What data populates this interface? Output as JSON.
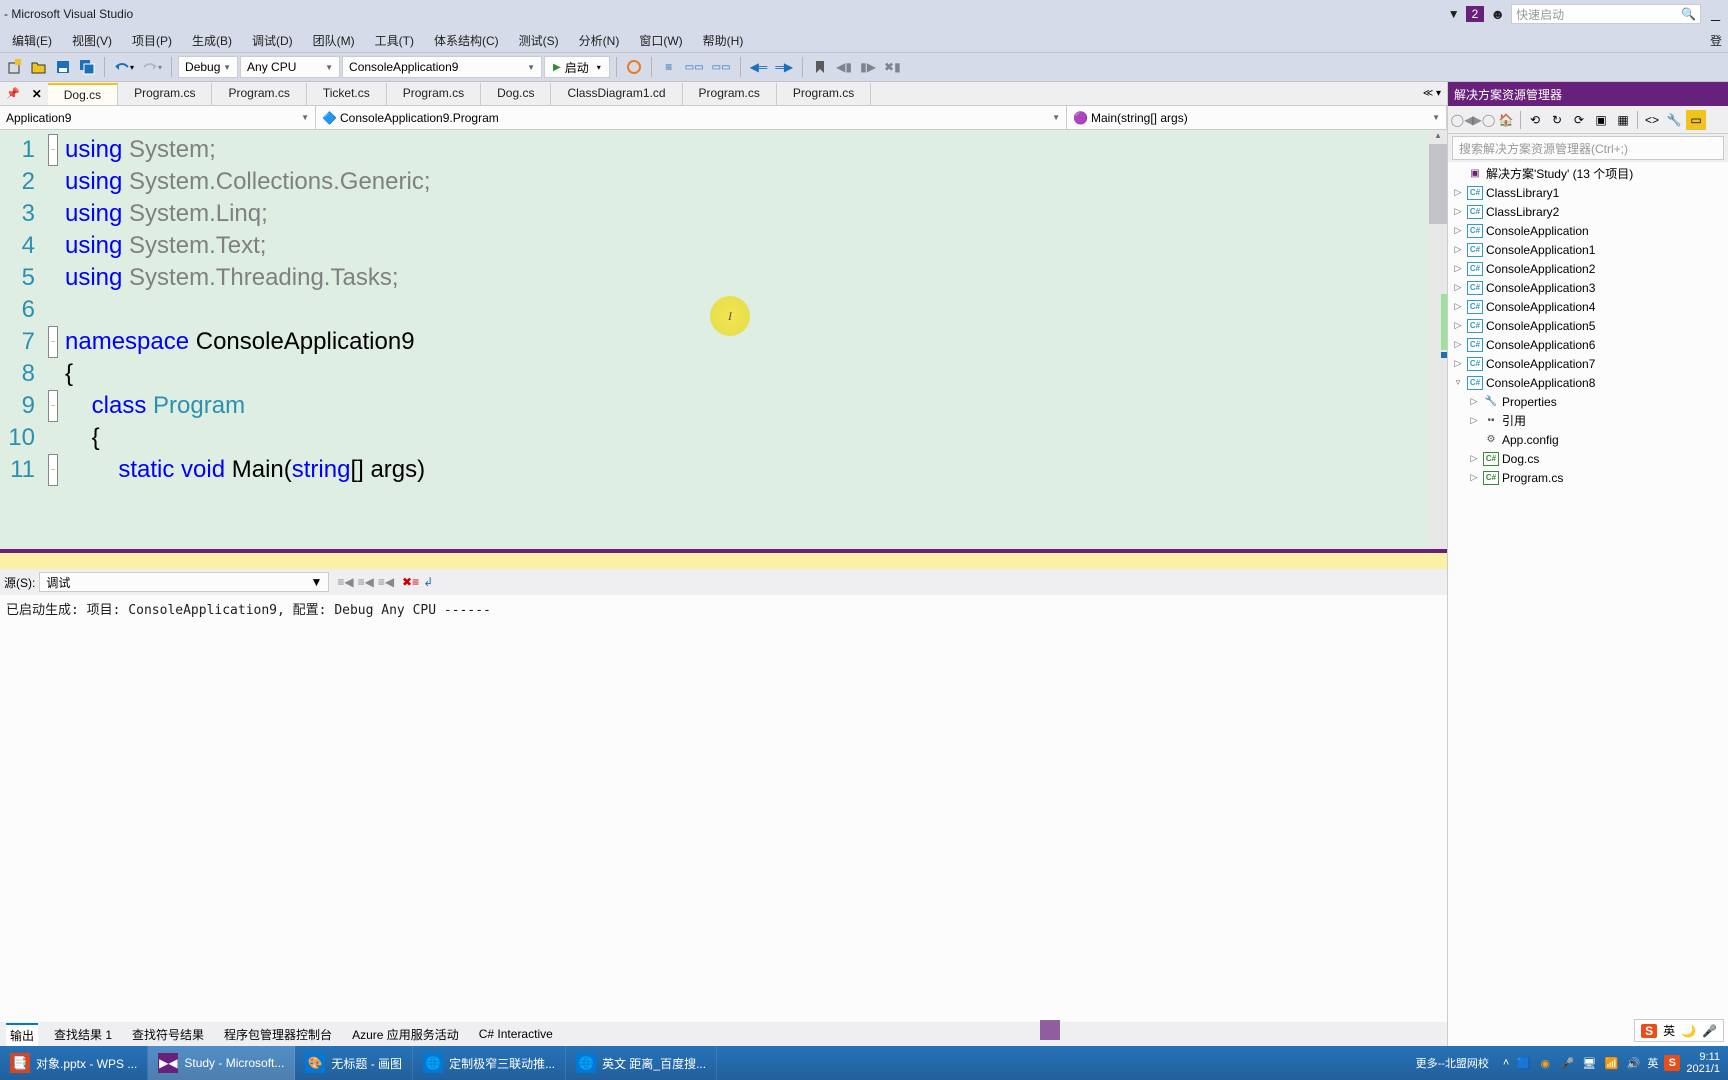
{
  "title": " - Microsoft Visual Studio",
  "notif_count": "2",
  "quick_launch_placeholder": "快速启动",
  "menu": [
    "编辑(E)",
    "视图(V)",
    "项目(P)",
    "生成(B)",
    "调试(D)",
    "团队(M)",
    "工具(T)",
    "体系结构(C)",
    "测试(S)",
    "分析(N)",
    "窗口(W)",
    "帮助(H)"
  ],
  "login": "登",
  "toolbar": {
    "config": "Debug",
    "platform": "Any CPU",
    "startup": "ConsoleApplication9",
    "start_label": "启动"
  },
  "tabs": [
    "Dog.cs",
    "Program.cs",
    "Program.cs",
    "Ticket.cs",
    "Program.cs",
    "Dog.cs",
    "ClassDiagram1.cd",
    "Program.cs",
    "Program.cs"
  ],
  "context": {
    "left": "Application9",
    "mid": "ConsoleApplication9.Program",
    "right": "Main(string[] args)"
  },
  "code_lines": [
    {
      "n": "1",
      "fold": "-",
      "html": "<span class='kw'>using</span> <span class='dim'>System;</span>"
    },
    {
      "n": "2",
      "fold": "",
      "html": "<span class='kw'>using</span> <span class='dim'>System.Collections.Generic;</span>"
    },
    {
      "n": "3",
      "fold": "",
      "html": "<span class='kw'>using</span> <span class='dim'>System.Linq;</span>"
    },
    {
      "n": "4",
      "fold": "",
      "html": "<span class='kw'>using</span> <span class='dim'>System.Text;</span>"
    },
    {
      "n": "5",
      "fold": "",
      "html": "<span class='kw'>using</span> <span class='dim'>System.Threading.Tasks;</span>"
    },
    {
      "n": "6",
      "fold": "",
      "html": ""
    },
    {
      "n": "7",
      "fold": "-",
      "html": "<span class='kw'>namespace</span> ConsoleApplication9"
    },
    {
      "n": "8",
      "fold": "",
      "html": "{"
    },
    {
      "n": "9",
      "fold": "-",
      "html": "    <span class='kw'>class</span> <span class='cls'>Program</span>"
    },
    {
      "n": "10",
      "fold": "",
      "html": "    {"
    },
    {
      "n": "11",
      "fold": "-",
      "html": "        <span class='kw'>static</span> <span class='kw'>void</span> Main(<span class='kw'>string</span>[] args)"
    }
  ],
  "output": {
    "source_label": "源(S):",
    "source_value": "调试",
    "text": "已启动生成: 项目: ConsoleApplication9, 配置: Debug Any CPU ------"
  },
  "bottom_tabs": [
    "输出",
    "查找结果 1",
    "查找符号结果",
    "程序包管理器控制台",
    "Azure 应用服务活动",
    "C# Interactive"
  ],
  "sol": {
    "title": "解决方案资源管理器",
    "search_placeholder": "搜索解决方案资源管理器(Ctrl+;)",
    "root": "解决方案'Study' (13 个项目)",
    "projects": [
      "ClassLibrary1",
      "ClassLibrary2",
      "ConsoleApplication",
      "ConsoleApplication1",
      "ConsoleApplication2",
      "ConsoleApplication3",
      "ConsoleApplication4",
      "ConsoleApplication5",
      "ConsoleApplication6",
      "ConsoleApplication7",
      "ConsoleApplication8"
    ],
    "expanded_children": [
      {
        "icon": "prop",
        "label": "Properties",
        "exp": "▷"
      },
      {
        "icon": "ref",
        "label": "引用",
        "exp": "▷"
      },
      {
        "icon": "cfg",
        "label": "App.config",
        "exp": ""
      },
      {
        "icon": "cs",
        "label": "Dog.cs",
        "exp": "▷"
      },
      {
        "icon": "cs",
        "label": "Program.cs",
        "exp": "▷"
      }
    ]
  },
  "taskbar": {
    "items": [
      {
        "icon": "word",
        "label": "对象.pptx - WPS ..."
      },
      {
        "icon": "vs",
        "label": "Study - Microsoft..."
      },
      {
        "icon": "paint",
        "label": "无标题 - 画图"
      },
      {
        "icon": "edge",
        "label": "定制极窄三联动推..."
      },
      {
        "icon": "edge2",
        "label": "英文 距离_百度搜..."
      }
    ],
    "more": "更多--北盟网校",
    "time": "9:11",
    "date": "2021/1"
  },
  "ime": {
    "label": "英"
  }
}
